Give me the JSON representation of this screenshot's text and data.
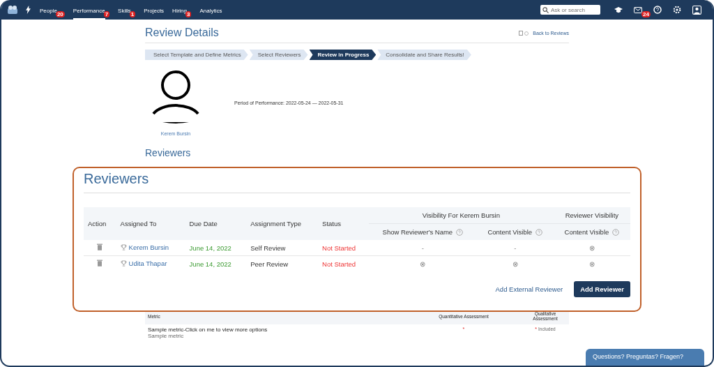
{
  "nav": {
    "items": [
      {
        "label": "People",
        "badge": "20",
        "selected": false
      },
      {
        "label": "Performance",
        "badge": "7",
        "selected": true
      },
      {
        "label": "Skills",
        "badge": "1",
        "selected": false
      },
      {
        "label": "Projects",
        "selected": false
      },
      {
        "label": "Hiring",
        "badge": "3",
        "selected": false
      },
      {
        "label": "Analytics",
        "selected": false
      }
    ],
    "search": {
      "placeholder": "Ask or search"
    },
    "mail_badge": "24"
  },
  "page": {
    "title": "Review Details",
    "back_link": "Back to Reviews",
    "steps": [
      {
        "label": "Select Template and Define Metrics",
        "selected": false
      },
      {
        "label": "Select Reviewers",
        "selected": false
      },
      {
        "label": "Review in Progress",
        "selected": true
      },
      {
        "label": "Consolidate and Share Results!",
        "selected": false
      }
    ],
    "profile_name": "Kerem Bursin",
    "period": "Period of Performance: 2022-05-24 — 2022-05-31",
    "section_heading": "Reviewers"
  },
  "reviewers": {
    "title": "Reviewers",
    "columns": [
      "Action",
      "Assigned To",
      "Due Date",
      "Assignment Type",
      "Status"
    ],
    "groups": [
      {
        "title": "Visibility For Kerem Bursin",
        "columns": [
          "Show Reviewer's Name",
          "Content Visible"
        ]
      },
      {
        "title": "Reviewer Visibility",
        "columns": [
          "Content Visible"
        ]
      }
    ],
    "rows": [
      {
        "assigned_to": "Kerem Bursin",
        "due_date": "June 14, 2022",
        "assignment_type": "Self Review",
        "status": "Not Started",
        "visibility": [
          "-",
          "-",
          "⊗"
        ]
      },
      {
        "assigned_to": "Udita Thapar",
        "due_date": "June 14, 2022",
        "assignment_type": "Peer Review",
        "status": "Not Started",
        "visibility": [
          "⊗",
          "⊗",
          "⊗"
        ]
      }
    ],
    "buttons": [
      {
        "label": "Add External Reviewer",
        "kind": "link"
      },
      {
        "label": "Add Reviewer",
        "kind": "primary"
      }
    ]
  },
  "metrics": {
    "columns": [
      "Metric",
      "Quantitative Assessment",
      "Qualitative Assessment"
    ],
    "rows": [
      {
        "metric": "Sample metric-Click on me to view more options",
        "subtitle": "Sample metric",
        "quantitative": "*",
        "qualitative_mark": "*",
        "qualitative": "Included"
      }
    ]
  },
  "chat_button": "Questions? Preguntas? Fragen?"
}
